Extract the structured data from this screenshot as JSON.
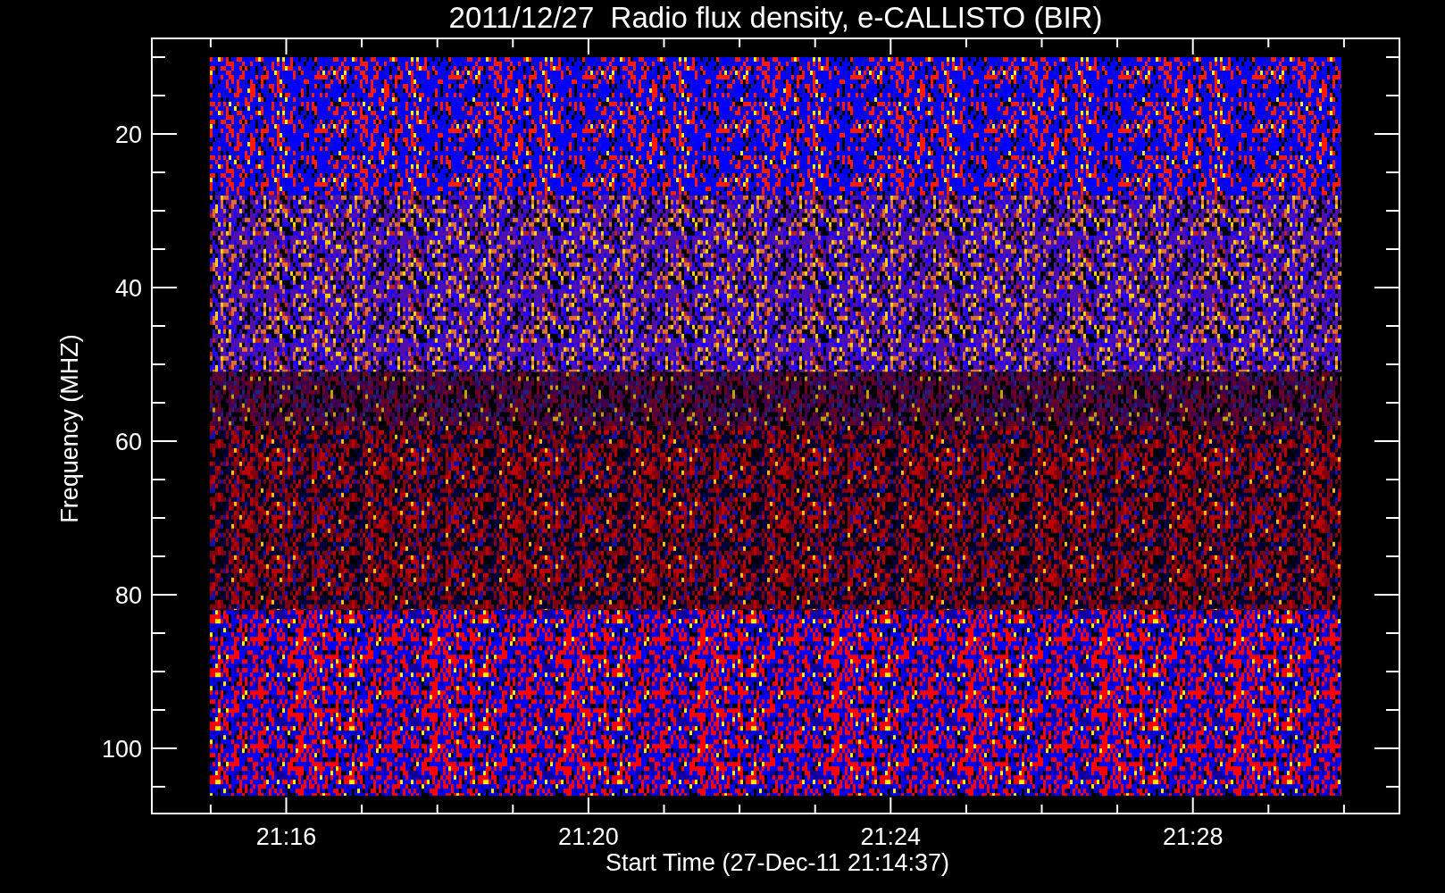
{
  "title": "2011/12/27  Radio flux density, e-CALLISTO (BIR)",
  "y_axis": {
    "label": "Frequency (MHZ)",
    "ticks": [
      "20",
      "40",
      "60",
      "80",
      "100"
    ]
  },
  "x_axis": {
    "label": "Start Time (27-Dec-11 21:14:37)",
    "ticks": [
      "21:16",
      "21:20",
      "21:24",
      "21:28"
    ]
  }
}
